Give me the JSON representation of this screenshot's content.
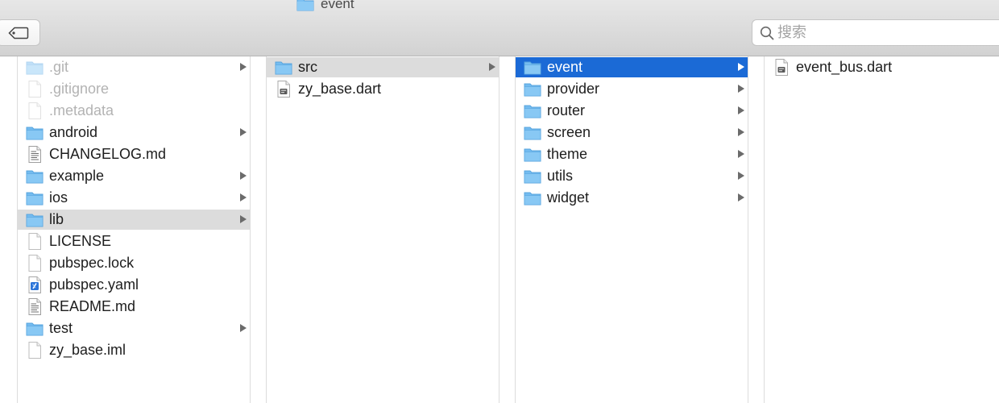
{
  "window": {
    "title": "event"
  },
  "toolbar": {
    "tag_button_icon": "tag-icon"
  },
  "search": {
    "placeholder": "搜索",
    "value": ""
  },
  "columns": [
    {
      "items": [
        {
          "label": ".git",
          "type": "folder",
          "arrow": true,
          "dim": true
        },
        {
          "label": ".gitignore",
          "type": "file",
          "arrow": false,
          "dim": true
        },
        {
          "label": ".metadata",
          "type": "file",
          "arrow": false,
          "dim": true
        },
        {
          "label": "android",
          "type": "folder",
          "arrow": true
        },
        {
          "label": "CHANGELOG.md",
          "type": "text",
          "arrow": false
        },
        {
          "label": "example",
          "type": "folder",
          "arrow": true
        },
        {
          "label": "ios",
          "type": "folder",
          "arrow": true
        },
        {
          "label": "lib",
          "type": "folder",
          "arrow": true,
          "selected": "gray"
        },
        {
          "label": "LICENSE",
          "type": "file",
          "arrow": false
        },
        {
          "label": "pubspec.lock",
          "type": "file",
          "arrow": false
        },
        {
          "label": "pubspec.yaml",
          "type": "yaml",
          "arrow": false
        },
        {
          "label": "README.md",
          "type": "text",
          "arrow": false
        },
        {
          "label": "test",
          "type": "folder",
          "arrow": true
        },
        {
          "label": "zy_base.iml",
          "type": "file",
          "arrow": false
        }
      ]
    },
    {
      "items": [
        {
          "label": "src",
          "type": "folder",
          "arrow": true,
          "selected": "gray"
        },
        {
          "label": "zy_base.dart",
          "type": "dart",
          "arrow": false
        }
      ]
    },
    {
      "items": [
        {
          "label": "event",
          "type": "folder",
          "arrow": true,
          "selected": "blue"
        },
        {
          "label": "provider",
          "type": "folder",
          "arrow": true
        },
        {
          "label": "router",
          "type": "folder",
          "arrow": true
        },
        {
          "label": "screen",
          "type": "folder",
          "arrow": true
        },
        {
          "label": "theme",
          "type": "folder",
          "arrow": true
        },
        {
          "label": "utils",
          "type": "folder",
          "arrow": true
        },
        {
          "label": "widget",
          "type": "folder",
          "arrow": true
        }
      ]
    },
    {
      "items": [
        {
          "label": "event_bus.dart",
          "type": "dart",
          "arrow": false
        }
      ]
    }
  ],
  "colors": {
    "folder_blue": "#6fb8ef",
    "selection_blue": "#1b6ad6",
    "selection_gray": "#dcdcdc"
  }
}
